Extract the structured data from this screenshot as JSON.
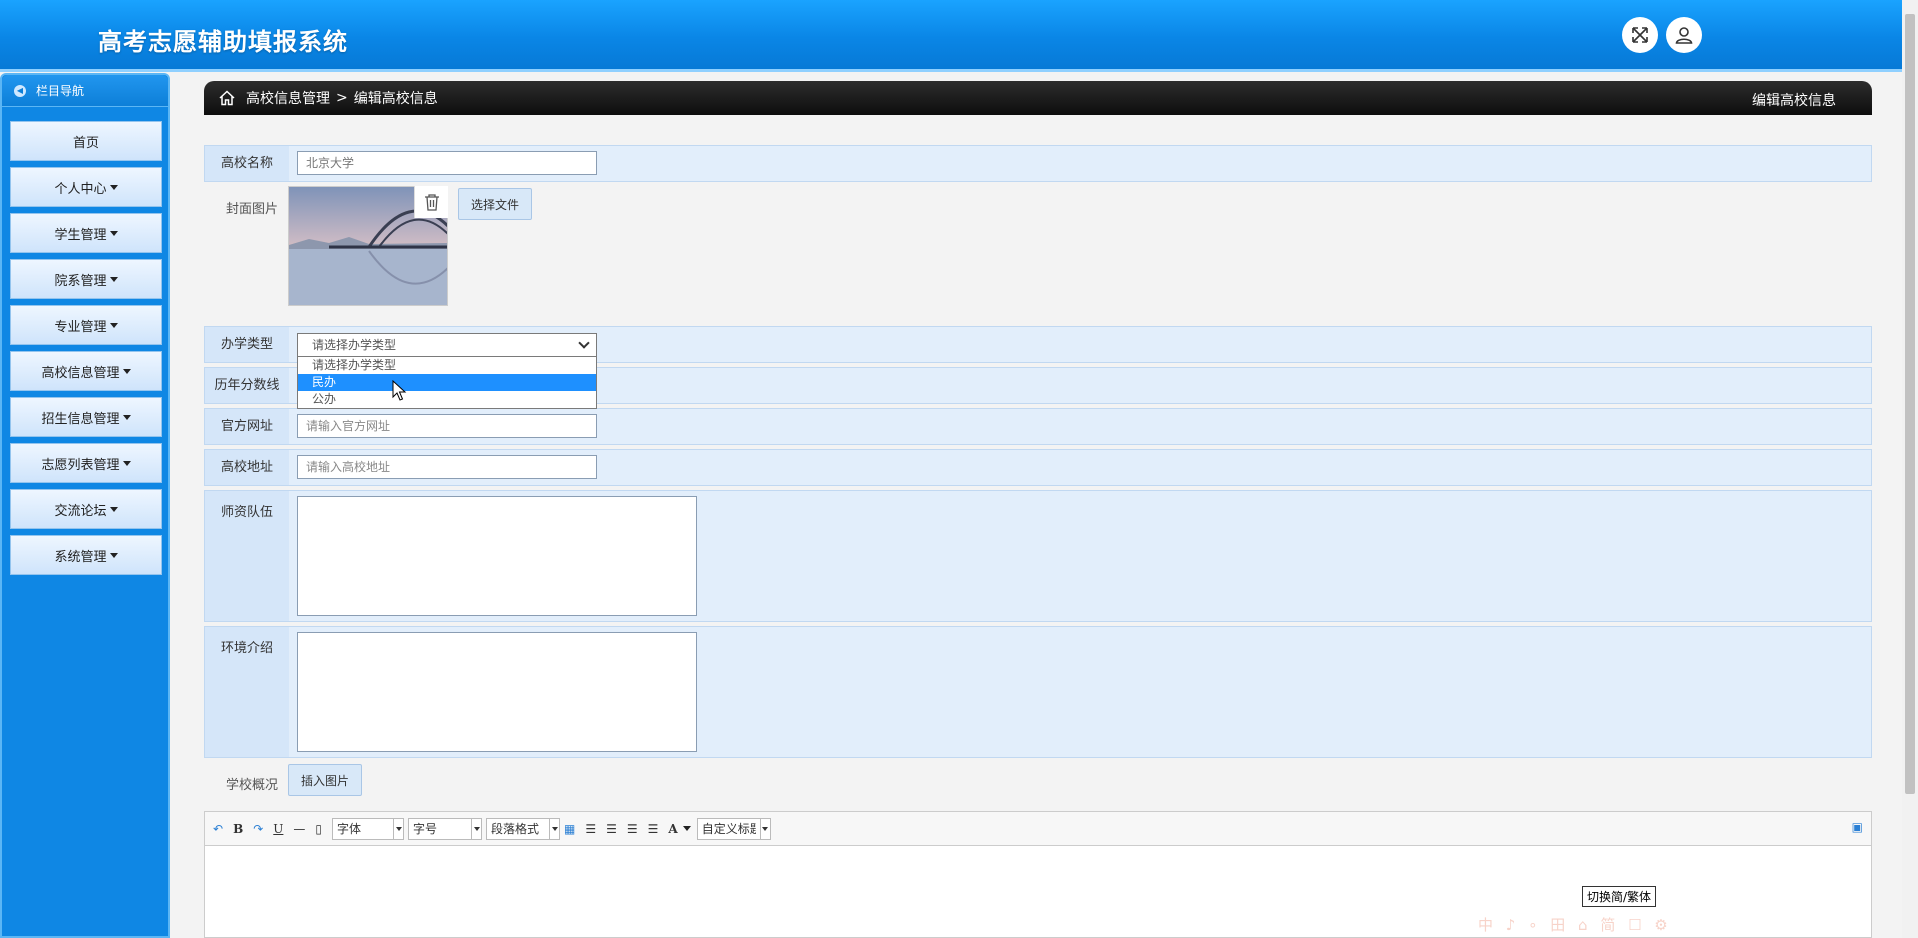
{
  "header": {
    "app_title": "高考志愿辅助填报系统",
    "fullscreen_icon": "fullscreen-icon",
    "user_icon": "user-icon"
  },
  "sidebar": {
    "heading": "栏目导航",
    "items": [
      {
        "label": "首页",
        "dropdown": false
      },
      {
        "label": "个人中心",
        "dropdown": true
      },
      {
        "label": "学生管理",
        "dropdown": true
      },
      {
        "label": "院系管理",
        "dropdown": true
      },
      {
        "label": "专业管理",
        "dropdown": true
      },
      {
        "label": "高校信息管理",
        "dropdown": true
      },
      {
        "label": "招生信息管理",
        "dropdown": true
      },
      {
        "label": "志愿列表管理",
        "dropdown": true
      },
      {
        "label": "交流论坛",
        "dropdown": true
      },
      {
        "label": "系统管理",
        "dropdown": true
      }
    ]
  },
  "breadcrumb": {
    "parent": "高校信息管理",
    "separator": ">",
    "current": "编辑高校信息",
    "right_title": "编辑高校信息"
  },
  "form": {
    "name_label": "高校名称",
    "name_value": "北京大学",
    "cover_label": "封面图片",
    "choose_file": "选择文件",
    "type_label": "办学类型",
    "type_selected": "请选择办学类型",
    "type_options": [
      "请选择办学类型",
      "民办",
      "公办"
    ],
    "type_highlighted_index": 1,
    "score_label": "历年分数线",
    "website_label": "官方网址",
    "website_placeholder": "请输入官方网址",
    "address_label": "高校地址",
    "address_placeholder": "请输入高校地址",
    "faculty_label": "师资队伍",
    "environment_label": "环境介绍",
    "overview_label": "学校概况",
    "insert_image": "插入图片"
  },
  "editor": {
    "bold": "B",
    "underline": "U",
    "font_family": "字体",
    "font_size": "字号",
    "paragraph": "段落格式",
    "font_color": "A",
    "custom_title": "自定义标题",
    "tooltip": "切换简/繁体",
    "watermark": "中 ♪ ∘ 田 ⌂ 简 ☐ ⚙"
  }
}
